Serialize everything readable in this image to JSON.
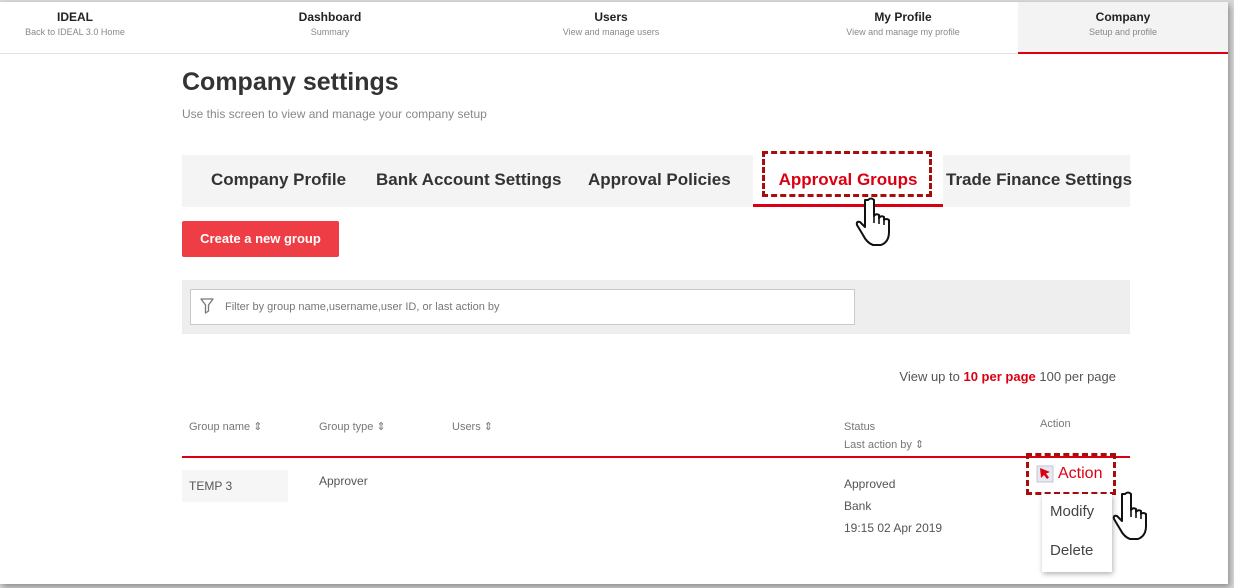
{
  "nav": {
    "home": {
      "title": "IDEAL",
      "subtitle": "Back to IDEAL 3.0 Home"
    },
    "dashboard": {
      "title": "Dashboard",
      "subtitle": "Summary"
    },
    "users": {
      "title": "Users",
      "subtitle": "View and manage users"
    },
    "profile": {
      "title": "My Profile",
      "subtitle": "View and manage my profile"
    },
    "company": {
      "title": "Company",
      "subtitle": "Setup and profile"
    }
  },
  "page": {
    "title": "Company settings",
    "subtitle": "Use this screen to view and manage your company setup"
  },
  "tabs": [
    {
      "label": "Company Profile"
    },
    {
      "label": "Bank Account Settings"
    },
    {
      "label": "Approval Policies"
    },
    {
      "label": "Approval Groups",
      "active": true
    },
    {
      "label": "Trade Finance Settings"
    }
  ],
  "create_button": "Create a new group",
  "filter": {
    "placeholder": "Filter by group name,username,user ID, or last action by",
    "icon": "filter-icon"
  },
  "pagination": {
    "prefix": "View up to",
    "selected": "10 per page",
    "other": "100 per page"
  },
  "table": {
    "headers": {
      "group_name": "Group name ⇕",
      "group_type": "Group type ⇕",
      "users": "Users ⇕",
      "status": "Status",
      "last_action": "Last action by ⇕",
      "action": "Action"
    },
    "rows": [
      {
        "group_name": "TEMP 3",
        "group_type": "Approver",
        "users": "",
        "status": "Approved",
        "last_action_by": "Bank",
        "last_action_time": "19:15 02 Apr 2019",
        "action": "Action"
      }
    ]
  },
  "action_menu": {
    "items": [
      "Modify",
      "Delete"
    ]
  },
  "colors": {
    "accent": "#db0011",
    "button": "#ee3d45",
    "highlight": "#a60d0d"
  }
}
